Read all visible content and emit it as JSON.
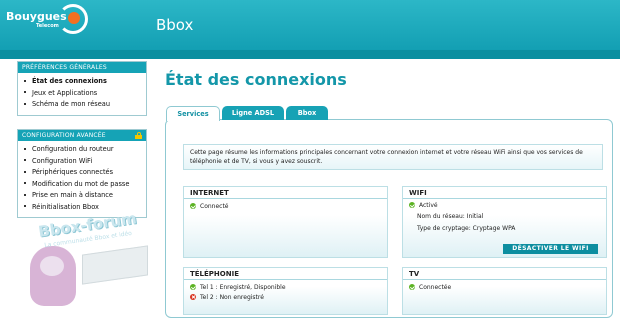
{
  "brand": {
    "name": "Bouygues",
    "sub": "Telecom"
  },
  "app_title": "Bbox",
  "sidebar": {
    "preferences": {
      "heading": "PRÉFÉRENCES GÉNÉRALES",
      "items": [
        {
          "label": "État des connexions",
          "active": true
        },
        {
          "label": "Jeux et Applications"
        },
        {
          "label": "Schéma de mon réseau"
        }
      ]
    },
    "advanced": {
      "heading": "CONFIGURATION AVANCÉE",
      "items": [
        {
          "label": "Configuration du routeur"
        },
        {
          "label": "Configuration WiFi"
        },
        {
          "label": "Périphériques connectés"
        },
        {
          "label": "Modification du mot de passe"
        },
        {
          "label": "Prise en main à distance"
        },
        {
          "label": "Réinitialisation Bbox"
        }
      ]
    }
  },
  "forum": {
    "title": "Bbox-forum",
    "subtitle": "La communauté Bbox et idéo"
  },
  "main": {
    "title": "État des connexions",
    "tabs": [
      {
        "label": "Services",
        "active": true
      },
      {
        "label": "Ligne ADSL"
      },
      {
        "label": "Bbox"
      }
    ],
    "intro": "Cette page résume les informations principales concernant votre connexion internet et votre réseau WiFi ainsi que vos services de téléphonie et de TV, si vous y avez souscrit.",
    "internet": {
      "title": "INTERNET",
      "status": "Connecté"
    },
    "wifi": {
      "title": "WIFI",
      "status": "Activé",
      "network_name": "Nom du réseau: Initial",
      "encryption": "Type de cryptage: Cryptage WPA",
      "button": "DÉSACTIVER LE WIFI"
    },
    "telephony": {
      "title": "TÉLÉPHONIE",
      "lines": [
        {
          "text": "Tel 1 : Enregistré, Disponible",
          "state": "ok"
        },
        {
          "text": "Tel 2 : Non enregistré",
          "state": "error"
        }
      ]
    },
    "tv": {
      "title": "TV",
      "status": "Connectée"
    }
  },
  "colors": {
    "accent": "#15a3b6",
    "ok": "#5cb323",
    "error": "#d8321f",
    "brand_orange": "#f37021"
  }
}
